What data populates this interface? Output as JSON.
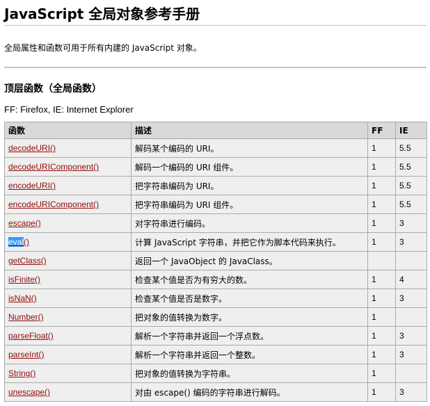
{
  "page": {
    "title": "JavaScript 全局对象参考手册",
    "intro": "全局属性和函数可用于所有内建的 JavaScript 对象。",
    "section_title": "顶层函数（全局函数）",
    "legend_note": "FF: Firefox, IE: Internet Explorer"
  },
  "table": {
    "headers": {
      "name": "函数",
      "desc": "描述",
      "ff": "FF",
      "ie": "IE"
    },
    "rows": [
      {
        "name": "decodeURI()",
        "desc": "解码某个编码的 URI。",
        "ff": "1",
        "ie": "5.5"
      },
      {
        "name": "decodeURIComponent()",
        "desc": "解码一个编码的 URI 组件。",
        "ff": "1",
        "ie": "5.5"
      },
      {
        "name": "encodeURI()",
        "desc": "把字符串编码为 URI。",
        "ff": "1",
        "ie": "5.5"
      },
      {
        "name": "encodeURIComponent()",
        "desc": "把字符串编码为 URI 组件。",
        "ff": "1",
        "ie": "5.5"
      },
      {
        "name": "escape()",
        "desc": "对字符串进行编码。",
        "ff": "1",
        "ie": "3"
      },
      {
        "name_selected": "eval",
        "name_rest": "()",
        "desc": "计算 JavaScript 字符串，并把它作为脚本代码来执行。",
        "ff": "1",
        "ie": "3"
      },
      {
        "name": "getClass()",
        "desc": "返回一个 JavaObject 的 JavaClass。",
        "ff": "",
        "ie": ""
      },
      {
        "name": "isFinite()",
        "desc": "检查某个值是否为有穷大的数。",
        "ff": "1",
        "ie": "4"
      },
      {
        "name": "isNaN()",
        "desc": "检查某个值是否是数字。",
        "ff": "1",
        "ie": "3"
      },
      {
        "name": "Number()",
        "desc": "把对象的值转换为数字。",
        "ff": "1",
        "ie": ""
      },
      {
        "name": "parseFloat()",
        "desc": "解析一个字符串并返回一个浮点数。",
        "ff": "1",
        "ie": "3"
      },
      {
        "name": "parseInt()",
        "desc": "解析一个字符串并返回一个整数。",
        "ff": "1",
        "ie": "3"
      },
      {
        "name": "String()",
        "desc": "把对象的值转换为字符串。",
        "ff": "1",
        "ie": ""
      },
      {
        "name": "unescape()",
        "desc": "对由 escape() 编码的字符串进行解码。",
        "ff": "1",
        "ie": "3"
      }
    ]
  },
  "colors": {
    "link": "#900b09",
    "header_bg": "#d9d9d9",
    "row_bg": "#efefef",
    "border": "#aaaaaa",
    "selection": "#3399ff"
  }
}
